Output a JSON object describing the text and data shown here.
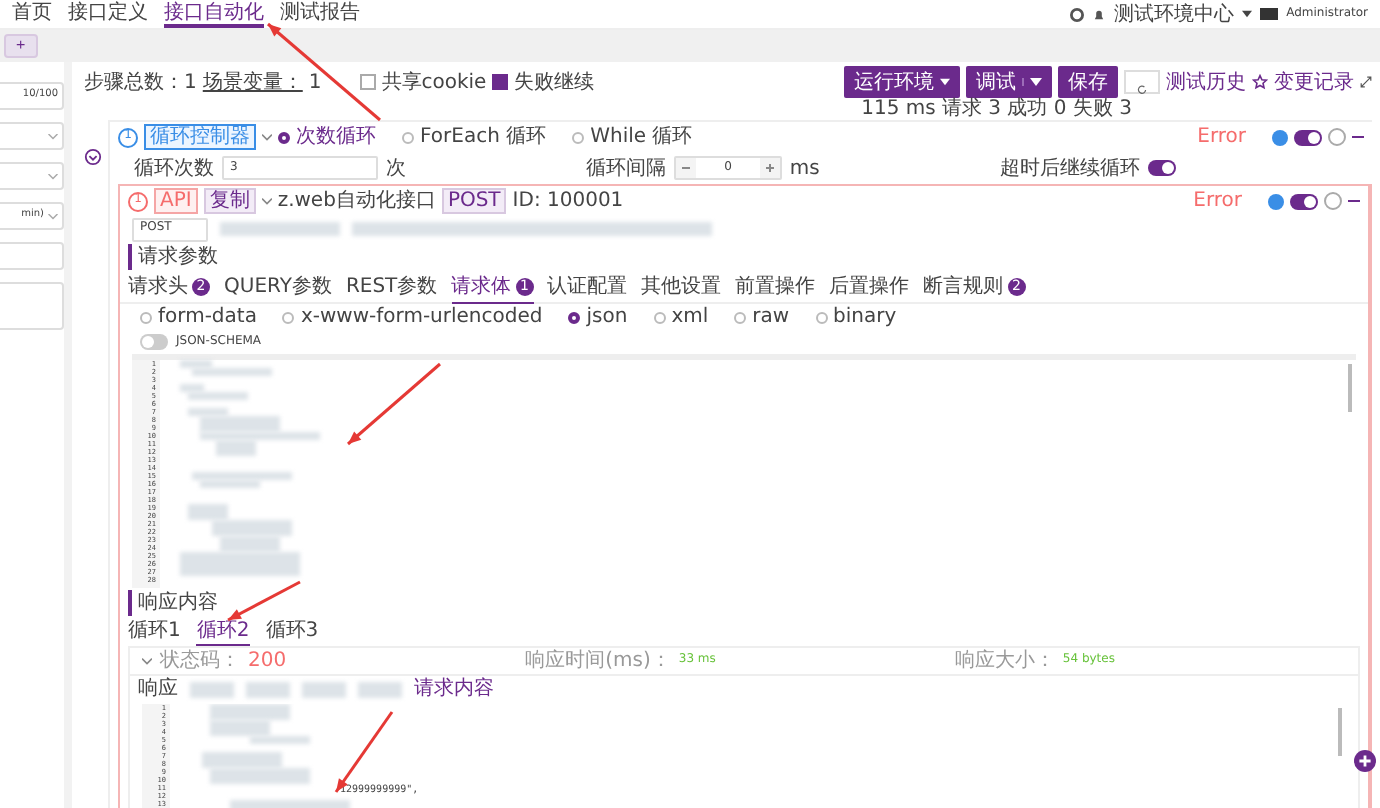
{
  "nav": {
    "items": [
      {
        "label": "首页",
        "selected": false
      },
      {
        "label": "接口定义",
        "selected": false
      },
      {
        "label": "接口自动化",
        "selected": true
      },
      {
        "label": "测试报告",
        "selected": false
      }
    ],
    "org": "测试环境中心",
    "user": "Administrator"
  },
  "tab_bar": {
    "add": "+"
  },
  "sidebar": {
    "fields": [
      {
        "kind": "input",
        "counter": "10/100"
      },
      {
        "kind": "select"
      },
      {
        "kind": "select"
      },
      {
        "kind": "select",
        "value": "min)"
      },
      {
        "kind": "input"
      },
      {
        "kind": "textarea"
      }
    ]
  },
  "toolbar": {
    "steps_label": "步骤总数：",
    "steps": "1",
    "vars_label": "场景变量：",
    "vars": "1",
    "share_cookie": {
      "label": "共享cookie",
      "checked": false
    },
    "continue_on_fail": {
      "label": "失败继续",
      "checked": true
    },
    "buttons": [
      {
        "label": "运行环境",
        "kind": "dropdown"
      },
      {
        "label": "调试",
        "kind": "split"
      },
      {
        "label": "保存",
        "kind": "plain"
      }
    ],
    "history": "测试历史",
    "changes": "变更记录",
    "summary": "115 ms 请求 3 成功 0 失败 3"
  },
  "loop_step": {
    "index": "1",
    "type": "循环控制器",
    "modes": [
      {
        "label": "次数循环",
        "selected": true
      },
      {
        "label": "ForEach 循环",
        "selected": false
      },
      {
        "label": "While 循环",
        "selected": false
      }
    ],
    "status": "Error",
    "enabled": true,
    "count_label": "循环次数",
    "count": "3",
    "count_unit": "次",
    "interval_label": "循环间隔",
    "interval": "0",
    "interval_unit": "ms",
    "timeout_label": "超时后继续循环",
    "timeout_continue": true
  },
  "api_step": {
    "index": "1",
    "tag": "API",
    "copy": "复制",
    "name": "z.web自动化接口",
    "method": "POST",
    "id": "ID: 100001",
    "status": "Error",
    "enabled": true,
    "url_method": "POST",
    "request_title": "请求参数",
    "tabs": [
      {
        "label": "请求头",
        "badge": "2",
        "selected": false
      },
      {
        "label": "QUERY参数",
        "selected": false
      },
      {
        "label": "REST参数",
        "selected": false
      },
      {
        "label": "请求体",
        "badge": "1",
        "selected": true
      },
      {
        "label": "认证配置",
        "selected": false
      },
      {
        "label": "其他设置",
        "selected": false
      },
      {
        "label": "前置操作",
        "selected": false
      },
      {
        "label": "后置操作",
        "selected": false
      },
      {
        "label": "断言规则",
        "badge": "2",
        "selected": false
      }
    ],
    "body_types": [
      {
        "label": "form-data",
        "selected": false
      },
      {
        "label": "x-www-form-urlencoded",
        "selected": false
      },
      {
        "label": "json",
        "selected": true
      },
      {
        "label": "xml",
        "selected": false
      },
      {
        "label": "raw",
        "selected": false
      },
      {
        "label": "binary",
        "selected": false
      }
    ],
    "json_schema": {
      "label": "JSON-SCHEMA",
      "on": false
    },
    "request_lines": [
      "1",
      "2",
      "3",
      "4",
      "5",
      "6",
      "7",
      "8",
      "9",
      "10",
      "11",
      "12",
      "13",
      "14",
      "15",
      "16",
      "17",
      "18",
      "19",
      "20",
      "21",
      "22",
      "23",
      "24",
      "25",
      "26",
      "27",
      "28"
    ],
    "response_title": "响应内容",
    "loops": [
      {
        "label": "循环1",
        "selected": false
      },
      {
        "label": "循环2",
        "selected": true
      },
      {
        "label": "循环3",
        "selected": false
      }
    ],
    "status_label": "状态码：",
    "status_code": "200",
    "time_label": "响应时间(ms)：",
    "time": "33 ms",
    "size_label": "响应大小：",
    "size": "54 bytes",
    "response_tabs": [
      {
        "label": "响应",
        "selected": false
      },
      {
        "label": "请求内容",
        "selected": true
      }
    ],
    "response_lines": [
      "1",
      "2",
      "3",
      "4",
      "5",
      "6",
      "7",
      "8",
      "9",
      "10",
      "11",
      "12",
      "13"
    ],
    "response_fragment": "12999999999\","
  }
}
